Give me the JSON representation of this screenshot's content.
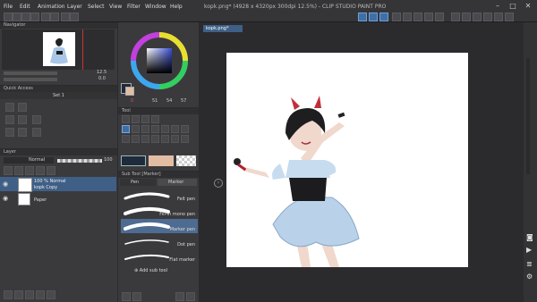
{
  "menu": [
    "File",
    "Edit",
    "Animation",
    "Layer",
    "Select",
    "View",
    "Filter",
    "Window",
    "Help"
  ],
  "window_title": "kopk.png* (4928 x 4320px 300dpi 12.5%)  - CLIP STUDIO PAINT PRO",
  "window_controls": {
    "minimize": "–",
    "maximize": "□",
    "close": "✕"
  },
  "navigator": {
    "title": "Navigator",
    "zoom": "12.5",
    "angle": "0.0"
  },
  "quick_access": {
    "title": "Quick Access",
    "set": "Set 1"
  },
  "color_panel": {
    "h": "0",
    "s": "51",
    "v": "54",
    "extra": "57"
  },
  "tool_panel": {
    "title": "Tool"
  },
  "canvas_tab": "kopk.png*",
  "layer_panel": {
    "title": "Layer",
    "blend_mode": "Normal",
    "opacity": "100",
    "layers": [
      {
        "name_line1": "100 % Normal",
        "name_line2": "kopk Copy",
        "selected": true
      },
      {
        "name_line1": "",
        "name_line2": "Paper",
        "selected": false
      }
    ]
  },
  "sub_tool": {
    "title": "Sub Tool [Marker]",
    "tabs": [
      "Pen",
      "Marker"
    ],
    "items": [
      {
        "label": "Felt pen",
        "selected": false
      },
      {
        "label": "Fill-in mono pen",
        "selected": false
      },
      {
        "label": "Marker pen",
        "selected": true
      },
      {
        "label": "Dot pen",
        "selected": false
      },
      {
        "label": "Flat marker",
        "selected": false
      }
    ],
    "add_label": "Add sub tool"
  },
  "colors": {
    "accent": "#3f6fa6",
    "main_color": "#1f2a3a",
    "sub_color": "#e2bda4",
    "canvas_bg": "#ffffff"
  }
}
